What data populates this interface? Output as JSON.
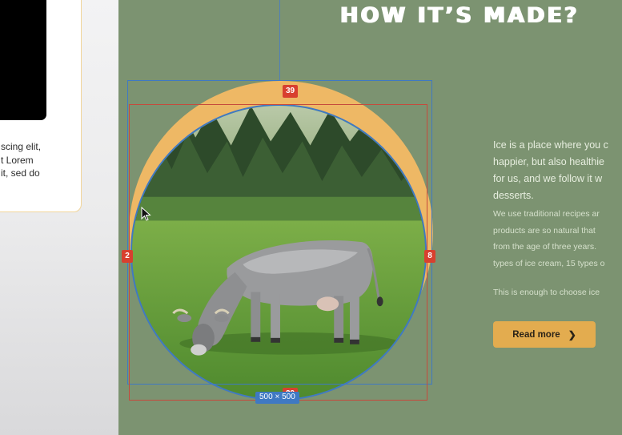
{
  "left_card": {
    "text": "scing elit,\nt Lorem\nit, sed do"
  },
  "section": {
    "heading": "HOW IT’S MADE?",
    "paragraph1": "Ice is a place where you c\nhappier, but also healthie\nfor us, and we follow it w\ndesserts.",
    "paragraph2": "We use traditional recipes ar\nproducts are so natural that\nfrom the age of three years.\ntypes of ice cream, 15 types o",
    "paragraph3": "This is enough to choose ice",
    "read_more_label": "Read more",
    "read_more_icon": "chevron-right-icon"
  },
  "image": {
    "subject": "cow-grazing-photo"
  },
  "selection_overlay": {
    "top_spacing": "39",
    "left_spacing": "2",
    "right_spacing": "8",
    "bottom_spacing": "29",
    "size_label": "500 × 500"
  },
  "colors": {
    "frame_background": "#7c9371",
    "accent": "#e3ac4f",
    "arc": "#eeb865",
    "measure_red": "#d8402f",
    "selection_blue": "#3f79c3"
  }
}
